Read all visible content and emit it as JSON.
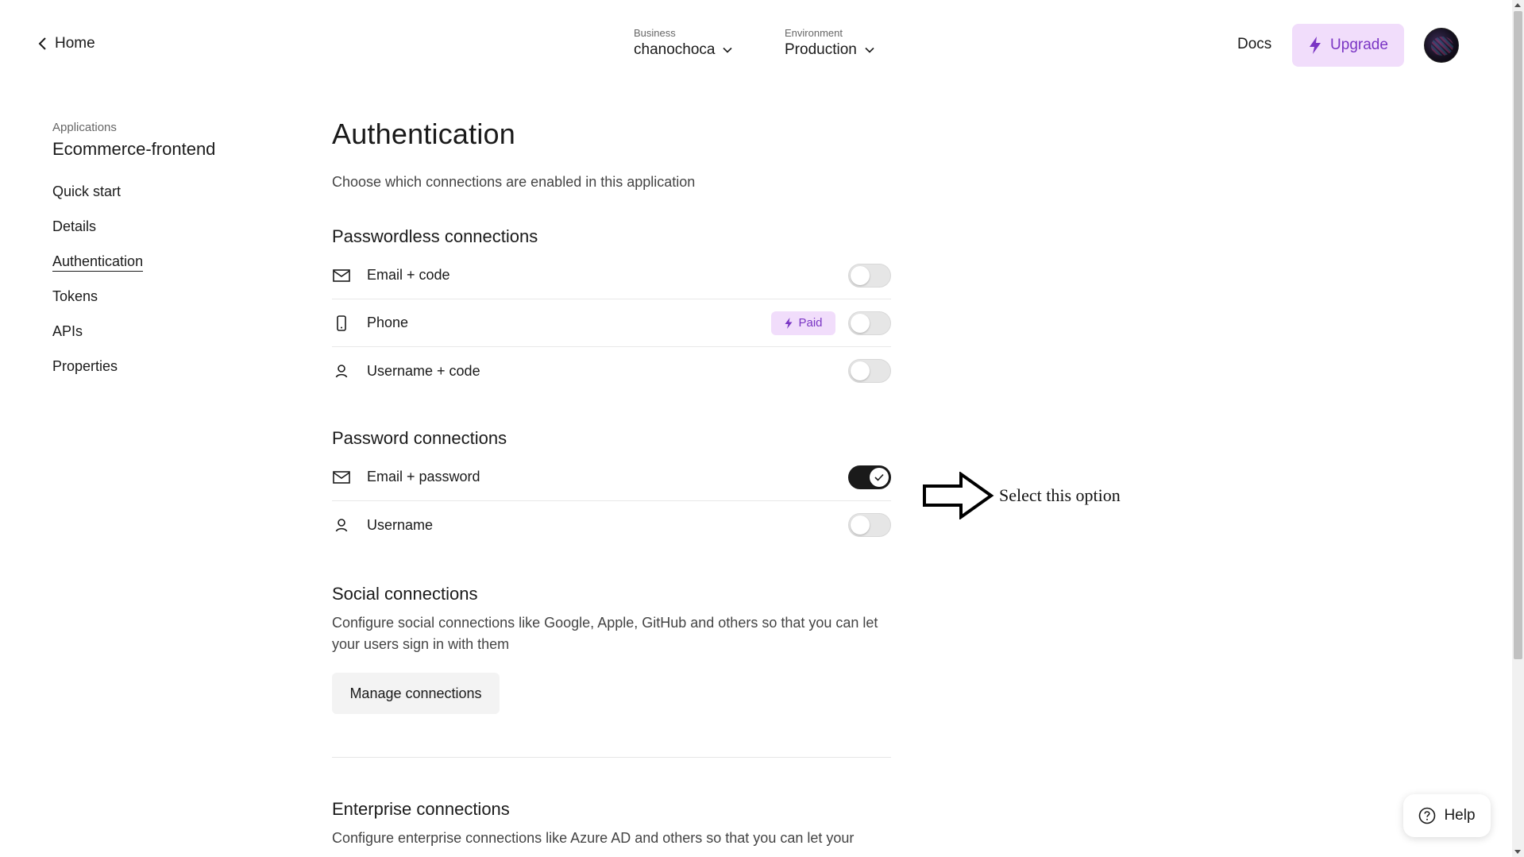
{
  "header": {
    "home_label": "Home",
    "business": {
      "label": "Business",
      "value": "chanochoca"
    },
    "environment": {
      "label": "Environment",
      "value": "Production"
    },
    "docs_label": "Docs",
    "upgrade_label": "Upgrade"
  },
  "sidebar": {
    "caption": "Applications",
    "title": "Ecommerce-frontend",
    "items": [
      {
        "label": "Quick start"
      },
      {
        "label": "Details"
      },
      {
        "label": "Authentication",
        "active": true
      },
      {
        "label": "Tokens"
      },
      {
        "label": "APIs"
      },
      {
        "label": "Properties"
      }
    ]
  },
  "main": {
    "title": "Authentication",
    "description": "Choose which connections are enabled in this application",
    "passwordless": {
      "title": "Passwordless connections",
      "items": [
        {
          "label": "Email + code",
          "icon": "mail-icon",
          "enabled": false
        },
        {
          "label": "Phone",
          "icon": "phone-icon",
          "badge": "Paid",
          "enabled": false
        },
        {
          "label": "Username + code",
          "icon": "user-icon",
          "enabled": false
        }
      ]
    },
    "password": {
      "title": "Password connections",
      "items": [
        {
          "label": "Email + password",
          "icon": "mail-icon",
          "enabled": true
        },
        {
          "label": "Username",
          "icon": "user-icon",
          "enabled": false
        }
      ]
    },
    "social": {
      "title": "Social connections",
      "description": "Configure social connections like Google, Apple, GitHub and others so that you can let your users sign in with them",
      "button_label": "Manage connections"
    },
    "enterprise": {
      "title": "Enterprise connections",
      "description": "Configure enterprise connections like Azure AD and others so that you can let your"
    }
  },
  "annotation": {
    "text": "Select this option"
  },
  "help": {
    "label": "Help"
  },
  "colors": {
    "accent": "#7a35c4",
    "accent_bg": "#f1ddfb",
    "toggle_on": "#1a1a1a",
    "toggle_off": "#e6e6e6"
  }
}
